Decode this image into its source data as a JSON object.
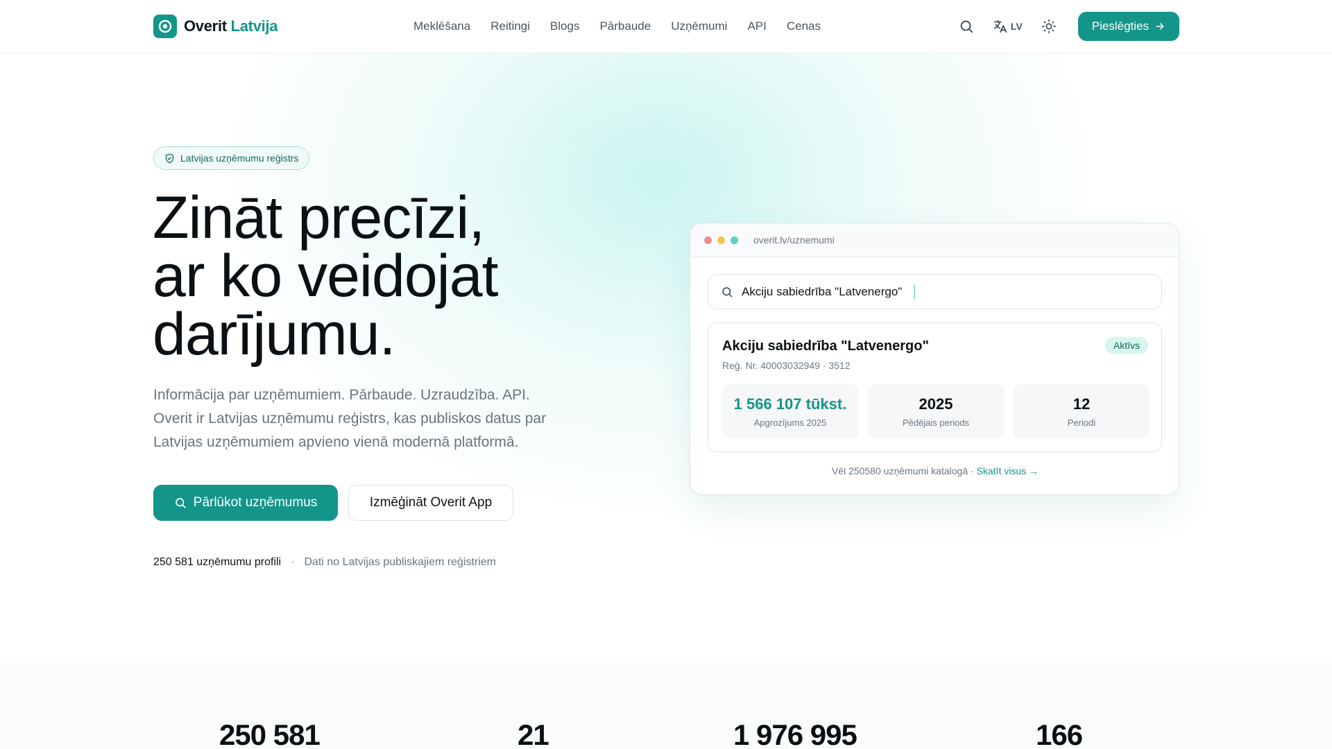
{
  "brand": {
    "name": "Overit",
    "accent_word": "Latvija",
    "color": "#14958a"
  },
  "nav": {
    "items": [
      "Meklēšana",
      "Reitingi",
      "Blogs",
      "Pārbaude",
      "Uzņēmumi",
      "API",
      "Cenas"
    ]
  },
  "header": {
    "lang": "LV",
    "login_label": "Pieslēgties"
  },
  "hero": {
    "badge": "Latvijas uzņēmumu reģistrs",
    "title_line1": "Zināt precīzi,",
    "title_line2": "ar ko veidojat",
    "title_line3": "darījumu.",
    "desc_line1": "Informācija par uzņēmumiem. Pārbaude. Uzraudzība. API.",
    "desc_line2": "Overit ir Latvijas uzņēmumu reģistrs, kas publiskos datus par",
    "desc_line3": "Latvijas uzņēmumiem apvieno vienā modernā platformā.",
    "cta_primary": "Pārlūkot uzņēmumus",
    "cta_secondary": "Izmēģināt Overit App",
    "meta_count": "250 581 uzņēmumu profili",
    "meta_sep": "·",
    "meta_source": "Dati no Latvijas publiskajiem reģistriem"
  },
  "mock": {
    "url": "overit.lv/uznemumi",
    "dot_colors": [
      "#f08a8a",
      "#f4c64e",
      "#5dd0c0"
    ],
    "search_value": "Akciju sabiedrība \"Latvenergo\"",
    "result": {
      "name": "Akciju sabiedrība \"Latvenergo\"",
      "reg": "Reģ. Nr. 40003032949 · 3512",
      "status": "Aktīvs",
      "metrics": [
        {
          "value": "1 566 107 tūkst.",
          "label": "Apgrozījums 2025"
        },
        {
          "value": "2025",
          "label": "Pēdējais periods"
        },
        {
          "value": "12",
          "label": "Periodi"
        }
      ]
    },
    "footer_text": "Vēl 250580 uzņēmumi katalogā ·",
    "footer_link": "Skatīt visus →"
  },
  "stats": {
    "values": [
      "250 581",
      "21",
      "1 976 995",
      "166"
    ]
  }
}
